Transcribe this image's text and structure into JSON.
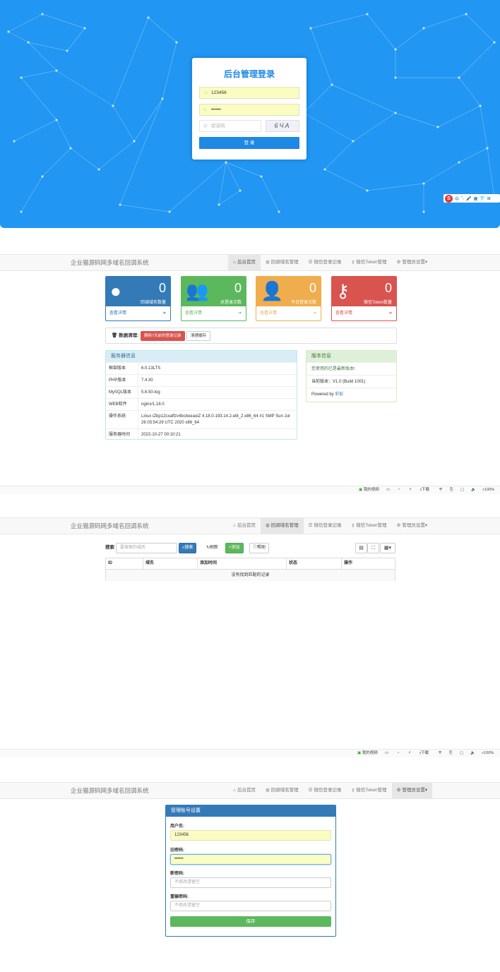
{
  "login": {
    "title": "后台管理登录",
    "username_value": "123456",
    "password_value": "••••••",
    "captcha_placeholder": "验证码",
    "captcha_text": "6ЧА",
    "submit_label": "登 录",
    "ime_items": [
      "中",
      "°,",
      "🎤",
      "▦",
      "👕",
      "⊞"
    ]
  },
  "nav": {
    "brand": "企业猫源码网多域名回调系统",
    "items": [
      {
        "label": "后台首页",
        "icon": "home-icon"
      },
      {
        "label": "回调域名管理",
        "icon": "globe-icon"
      },
      {
        "label": "微信登录记录",
        "icon": "list-icon"
      },
      {
        "label": "微信Token管理",
        "icon": "key-icon"
      },
      {
        "label": "管理员设置▾",
        "icon": "gear-icon"
      }
    ]
  },
  "dashboard": {
    "stats": [
      {
        "value": "0",
        "label": "回调域名数量",
        "link": "查看详情",
        "color": "#337ab7",
        "icon": "globe-icon"
      },
      {
        "value": "0",
        "label": "总登录次数",
        "link": "查看详情",
        "color": "#5cb85c",
        "icon": "users-icon"
      },
      {
        "value": "0",
        "label": "今日登录次数",
        "link": "查看详情",
        "color": "#f0ad4e",
        "icon": "user-icon"
      },
      {
        "value": "0",
        "label": "微信Token数量",
        "link": "查看详情",
        "color": "#d9534f",
        "icon": "key-icon"
      }
    ],
    "cleanup": {
      "label": "数据清理:",
      "delete_button": "删除7天前的登录记录",
      "clear_cache_button": "清理缓存"
    },
    "server": {
      "title": "服务器信息",
      "rows": [
        {
          "key": "框架版本",
          "value": "6.0.13LTS"
        },
        {
          "key": "PHP版本",
          "value": "7.4.30"
        },
        {
          "key": "MySQL版本",
          "value": "5.6.50-log"
        },
        {
          "key": "WEB软件",
          "value": "nginx/1.18.0"
        },
        {
          "key": "操作系统",
          "value": "Linux iZbp12cxaffzv4bcboeaoiZ 4.18.0-193.14.2.el8_2.x86_64 #1 SMP Sun Jul 26 03:54:29 UTC 2020 x86_64"
        },
        {
          "key": "服务器时间",
          "value": "2022-10-27 00:10:21"
        }
      ]
    },
    "version": {
      "title": "版本信息",
      "latest": "您使用的已是最新版本!",
      "current": "当前版本：V1.0 (Build 1001)",
      "powered_prefix": "Powered by ",
      "powered_link": "彩虹"
    }
  },
  "statusbar": {
    "video": "我的视频",
    "download": "下载",
    "zoom": "100%"
  },
  "domains": {
    "search_label": "搜索",
    "search_placeholder": "要搜索的域名",
    "search_button": "搜索",
    "refresh_button": "刷新",
    "add_button": "添加",
    "help_button": "帮助",
    "columns": [
      "ID",
      "域名",
      "添加时间",
      "状态",
      "操作"
    ],
    "empty_text": "没有找到匹配的记录"
  },
  "account": {
    "title": "管理账号设置",
    "username_label": "用户名:",
    "username_value": "123456",
    "old_password_label": "旧密码:",
    "old_password_value": "••••••",
    "new_password_label": "新密码:",
    "new_password_placeholder": "不修改请留空",
    "repeat_password_label": "重输密码:",
    "repeat_password_placeholder": "不修改请留空",
    "save_button": "保存"
  }
}
